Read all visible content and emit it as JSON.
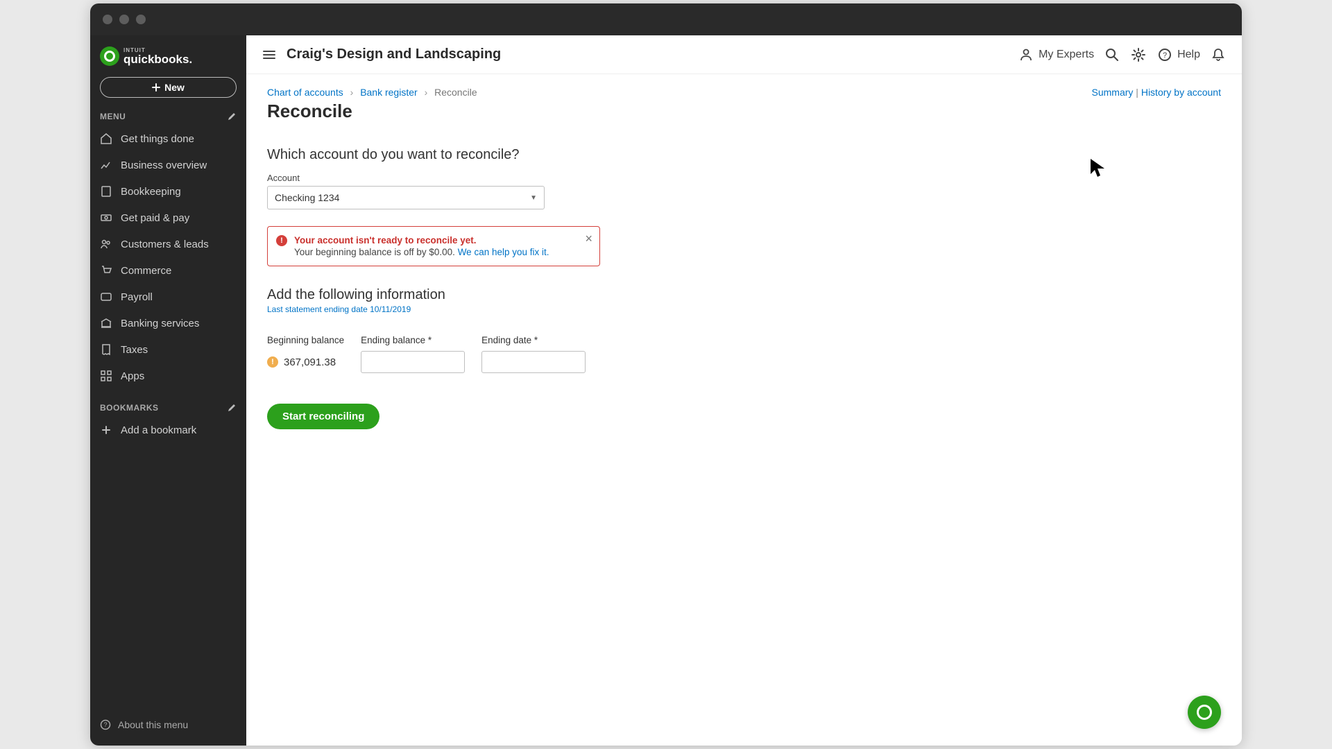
{
  "brand": {
    "intuit": "INTUIT",
    "name": "quickbooks."
  },
  "new_button": "New",
  "menu_header": "MENU",
  "menu_items": [
    {
      "label": "Get things done"
    },
    {
      "label": "Business overview"
    },
    {
      "label": "Bookkeeping"
    },
    {
      "label": "Get paid & pay"
    },
    {
      "label": "Customers & leads"
    },
    {
      "label": "Commerce"
    },
    {
      "label": "Payroll"
    },
    {
      "label": "Banking services"
    },
    {
      "label": "Taxes"
    },
    {
      "label": "Apps"
    }
  ],
  "bookmarks_header": "BOOKMARKS",
  "add_bookmark": "Add a bookmark",
  "about_menu": "About this menu",
  "topbar": {
    "company": "Craig's Design and Landscaping",
    "my_experts": "My Experts",
    "help": "Help"
  },
  "breadcrumbs": {
    "chart_of_accounts": "Chart of accounts",
    "bank_register": "Bank register",
    "current": "Reconcile"
  },
  "top_links": {
    "summary": "Summary",
    "sep": " | ",
    "history": "History by account"
  },
  "page_title": "Reconcile",
  "question": "Which account do you want to reconcile?",
  "account_label": "Account",
  "account_selected": "Checking 1234",
  "alert": {
    "title": "Your account isn't ready to reconcile yet.",
    "body_prefix": "Your beginning balance is off by $0.00. ",
    "link": "We can help you fix it."
  },
  "add_info_title": "Add the following information",
  "last_statement_prefix": "Last statement ending date ",
  "last_statement_date": "10/11/2019",
  "fields": {
    "beginning_balance": "Beginning balance",
    "beginning_balance_value": "367,091.38",
    "ending_balance": "Ending balance *",
    "ending_date": "Ending date *"
  },
  "start_button": "Start reconciling"
}
